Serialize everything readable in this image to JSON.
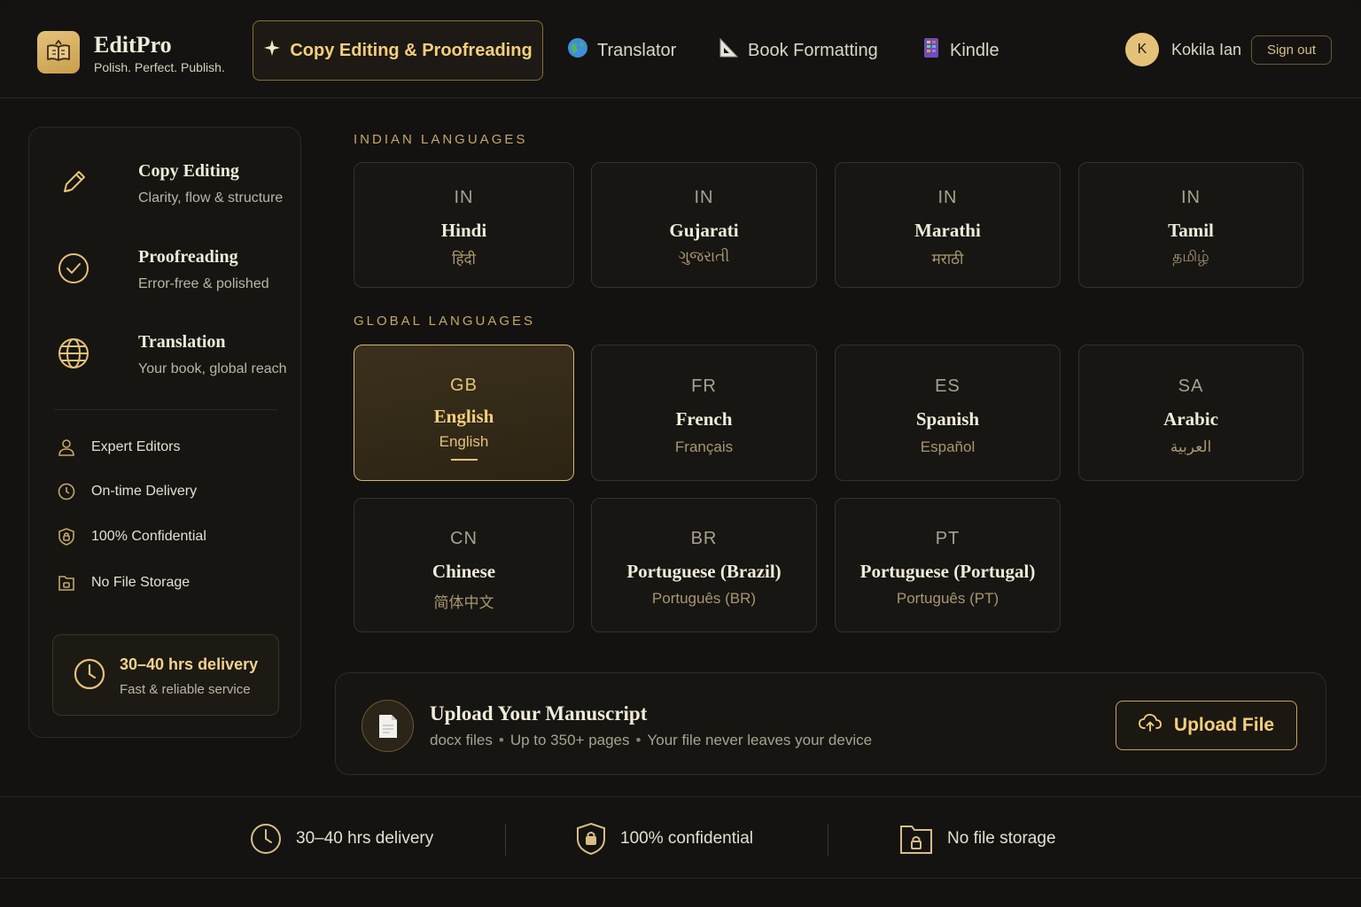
{
  "colors": {
    "accent": "#e4c27a",
    "accent_text": "#f4cf7c",
    "background": "#131210",
    "panel": "#161512"
  },
  "brand": {
    "name": "EditPro",
    "tagline": "Polish. Perfect. Publish.",
    "logo_icon": "open-book-icon"
  },
  "nav": {
    "items": [
      {
        "label": "Copy Editing & Proofreading",
        "icon": "sparkle-icon",
        "active": true
      },
      {
        "label": "Translator",
        "icon": "globe-icon",
        "active": false
      },
      {
        "label": "Book Formatting",
        "icon": "triangle-ruler-icon",
        "active": false
      },
      {
        "label": "Kindle",
        "icon": "kindle-device-icon",
        "active": false
      }
    ]
  },
  "user": {
    "initial": "K",
    "name": "Kokila Ian",
    "signout_label": "Sign out"
  },
  "sidebar": {
    "services": [
      {
        "title": "Copy Editing",
        "subtitle": "Clarity, flow & structure",
        "icon": "pencil-icon"
      },
      {
        "title": "Proofreading",
        "subtitle": "Error-free & polished",
        "icon": "check-circle-icon"
      },
      {
        "title": "Translation",
        "subtitle": "Your book, global reach",
        "icon": "globe-icon"
      }
    ],
    "features": [
      {
        "label": "Expert Editors",
        "icon": "user-icon"
      },
      {
        "label": "On-time Delivery",
        "icon": "clock-icon"
      },
      {
        "label": "100% Confidential",
        "icon": "shield-lock-icon"
      },
      {
        "label": "No File Storage",
        "icon": "folder-lock-icon"
      }
    ],
    "delivery": {
      "title": "30–40 hrs delivery",
      "subtitle": "Fast & reliable service"
    }
  },
  "sections": {
    "indian_label": "INDIAN LANGUAGES",
    "global_label": "GLOBAL LANGUAGES"
  },
  "indian_languages": [
    {
      "code": "IN",
      "name": "Hindi",
      "native": "हिंदी"
    },
    {
      "code": "IN",
      "name": "Gujarati",
      "native": "ગુજરાતી"
    },
    {
      "code": "IN",
      "name": "Marathi",
      "native": "मराठी"
    },
    {
      "code": "IN",
      "name": "Tamil",
      "native": "தமிழ்"
    }
  ],
  "global_languages": [
    {
      "code": "GB",
      "name": "English",
      "native": "English",
      "selected": true
    },
    {
      "code": "FR",
      "name": "French",
      "native": "Français",
      "selected": false
    },
    {
      "code": "ES",
      "name": "Spanish",
      "native": "Español",
      "selected": false
    },
    {
      "code": "SA",
      "name": "Arabic",
      "native": "العربية",
      "selected": false
    },
    {
      "code": "CN",
      "name": "Chinese",
      "native": "简体中文",
      "selected": false
    },
    {
      "code": "BR",
      "name": "Portuguese (Brazil)",
      "native": "Português (BR)",
      "selected": false
    },
    {
      "code": "PT",
      "name": "Portuguese (Portugal)",
      "native": "Português (PT)",
      "selected": false
    }
  ],
  "upload": {
    "title": "Upload Your Manuscript",
    "details": [
      "docx files",
      "Up to 350+ pages",
      "Your file never leaves your device"
    ],
    "separator": "•",
    "button_label": "Upload File"
  },
  "footer": {
    "items": [
      {
        "label": "30–40 hrs delivery",
        "icon": "clock-icon"
      },
      {
        "label": "100% confidential",
        "icon": "shield-lock-icon"
      },
      {
        "label": "No file storage",
        "icon": "folder-lock-icon"
      }
    ]
  }
}
